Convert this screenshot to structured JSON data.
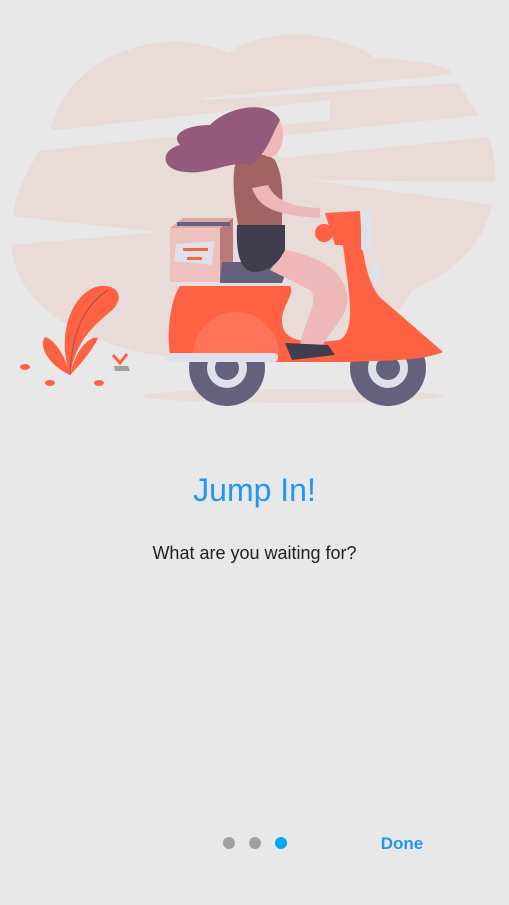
{
  "onboarding": {
    "title": "Jump In!",
    "subtitle": "What are you waiting for?",
    "page_count": 3,
    "current_page": 3,
    "done_label": "Done",
    "illustration": "woman-riding-scooter-illustration"
  },
  "colors": {
    "accent": "#2196f3",
    "active_dot": "#03a9f4",
    "inactive_dot": "#a0a0a0",
    "background": "#e8e8e8",
    "scooter": "#ff6243"
  }
}
